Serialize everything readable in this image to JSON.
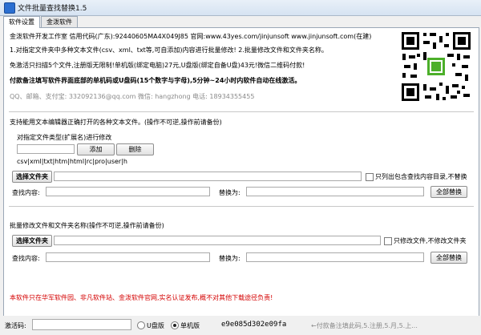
{
  "window": {
    "title": "文件批量查找替换1.5"
  },
  "tabs": [
    {
      "label": "软件设置"
    },
    {
      "label": "金泼软件"
    }
  ],
  "info": {
    "line1": "金泼软件开发工作室 信用代码(广东):92440605MA4X049J85 官网:www.43yes.com/jinjunsoft  www.jinjunsoft.com(在建)",
    "line2": "1.对指定文件夹中多种文本文件(csv、xml、txt等,可自添加)内容进行批量修改! 2.批量修改文件和文件夹名称。",
    "line3": "免激活只扫描5个文件,注册版无限制!单机版(绑定电脑)27元,U盘版(绑定自备U盘)43元!微信二维码付款!",
    "line4": "付款备注填写软件界面底部的单机码或U盘码(15个数字与字母),5分钟~24小时内软件自动在线激活。",
    "line5": "QQ、邮箱、支付宝: 332092136@qq.com      微信: hangzhong     电话: 18934355455"
  },
  "section1": {
    "heading": "支持能用文本编辑器正确打开的各种文本文件。(操作不可逆,操作前请备份)",
    "type_label": "对指定文件类型(扩展名)进行修改",
    "ext_input_value": "",
    "add_button": "添加",
    "delete_button": "删除",
    "ext_list": "csv|xml|txt|htm|html|rc|pro|user|h",
    "select_folder_button": "选择文件夹",
    "folder_value": "",
    "only_folder_checkbox": "只列出包含查找内容目录,不替换",
    "find_label": "查找内容:",
    "find_value": "",
    "replace_label": "替换为:",
    "replace_value": "",
    "replace_all_button": "全部替换"
  },
  "section2": {
    "heading": "批量修改文件和文件夹名称(操作不可逆,操作前请备份)",
    "select_folder_button": "选择文件夹",
    "folder_value": "",
    "only_files_checkbox": "只修改文件,不修改文件夹",
    "find_label": "查找内容:",
    "find_value": "",
    "replace_label": "替换为:",
    "replace_value": "",
    "replace_all_button": "全部替换"
  },
  "notice": "本软件只在华军软件园、非凡软件站、金泼软件官网,实名认证发布,概不对其他下载途径负责!",
  "statusbar": {
    "activation_label": "激活码:",
    "activation_value": "",
    "usb_label": "U盘版",
    "standalone_label": "单机版",
    "machine_code": "e9e085d302e09fa",
    "hint": "←付款备注填此码,5.注册,5.月,5.上..."
  },
  "colors": {
    "accent": "#2b6fd1",
    "notice": "#d40000",
    "qr_badge": "#4caf2a"
  },
  "icons": {
    "app": "app-icon",
    "qr": "qr-code"
  }
}
